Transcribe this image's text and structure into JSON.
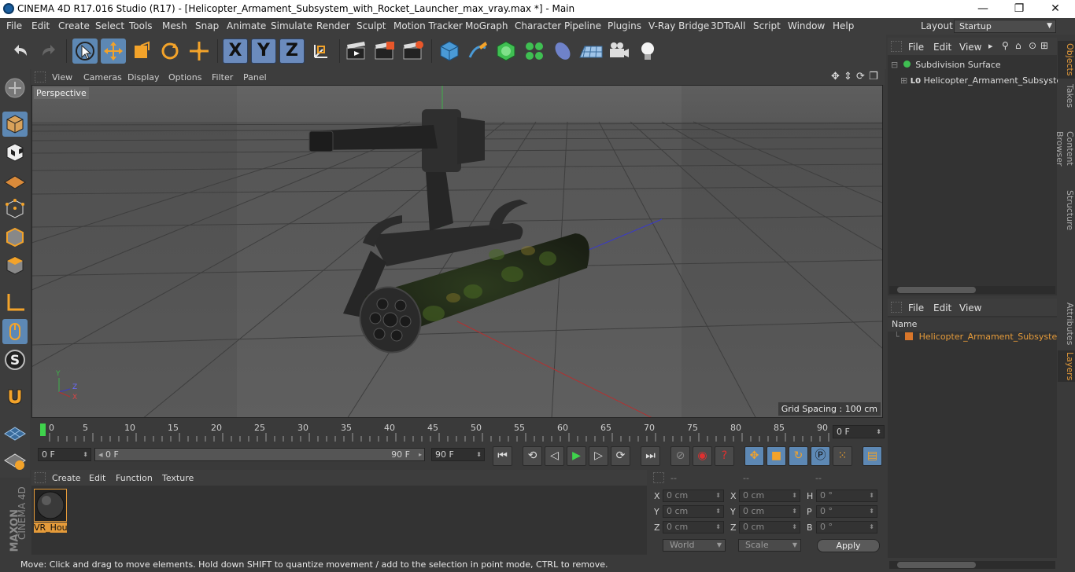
{
  "window": {
    "title": "CINEMA 4D R17.016 Studio (R17) - [Helicopter_Armament_Subsystem_with_Rocket_Launcher_max_vray.max *] - Main",
    "minimize": "—",
    "maximize": "❐",
    "close": "✕"
  },
  "menubar": {
    "items": [
      "File",
      "Edit",
      "Create",
      "Select",
      "Tools",
      "Mesh",
      "Snap",
      "Animate",
      "Simulate",
      "Render",
      "Sculpt",
      "Motion Tracker",
      "MoGraph",
      "Character",
      "Pipeline",
      "Plugins",
      "V-Ray Bridge",
      "3DToAll",
      "Script",
      "Window",
      "Help"
    ],
    "layout_label": "Layout:",
    "layout_value": "Startup"
  },
  "toolbar": {
    "axis_x": "X",
    "axis_y": "Y",
    "axis_z": "Z"
  },
  "viewport": {
    "menu": [
      "View",
      "Cameras",
      "Display",
      "Options",
      "Filter",
      "Panel"
    ],
    "camera_label": "Perspective",
    "grid_spacing": "Grid Spacing : 100 cm",
    "axis_labels": {
      "y": "Y",
      "z": "Z",
      "x": "X"
    }
  },
  "timeline": {
    "ticks": [
      "0",
      "5",
      "10",
      "15",
      "20",
      "25",
      "30",
      "35",
      "40",
      "45",
      "50",
      "55",
      "60",
      "65",
      "70",
      "75",
      "80",
      "85",
      "90"
    ],
    "current_frame": "0 F"
  },
  "timecontrols": {
    "start_field": "0 F",
    "slider_left": "0 F",
    "slider_right": "90 F",
    "end_field": "90 F"
  },
  "material_panel": {
    "menu": [
      "Create",
      "Edit",
      "Function",
      "Texture"
    ],
    "materials": [
      {
        "name": "VR_Hou"
      }
    ]
  },
  "coordinates": {
    "header": [
      "--",
      "--",
      "--"
    ],
    "rows": [
      {
        "l1": "X",
        "v1": "0 cm",
        "l2": "X",
        "v2": "0 cm",
        "l3": "H",
        "v3": "0 °"
      },
      {
        "l1": "Y",
        "v1": "0 cm",
        "l2": "Y",
        "v2": "0 cm",
        "l3": "P",
        "v3": "0 °"
      },
      {
        "l1": "Z",
        "v1": "0 cm",
        "l2": "Z",
        "v2": "0 cm",
        "l3": "B",
        "v3": "0 °"
      }
    ],
    "space": "World",
    "mode": "Scale",
    "apply": "Apply"
  },
  "status": "Move: Click and drag to move elements. Hold down SHIFT to quantize movement / add to the selection in point mode, CTRL to remove.",
  "brand": {
    "maxon": "MAXON",
    "c4d": "CINEMA 4D"
  },
  "object_manager": {
    "menu": [
      "File",
      "Edit",
      "View"
    ],
    "objects": [
      {
        "name": "Subdivision Surface"
      },
      {
        "name": "Helicopter_Armament_Subsystem"
      }
    ],
    "child_tag": "L0"
  },
  "layer_manager": {
    "menu": [
      "File",
      "Edit",
      "View"
    ],
    "column_name": "Name",
    "layers": [
      {
        "name": "Helicopter_Armament_Subsystem_"
      }
    ]
  },
  "side_tabs": [
    "Objects",
    "Takes",
    "Content Browser",
    "Structure",
    "Attributes",
    "Layers"
  ],
  "colors": {
    "accent": "#5d88b4",
    "selection_orange": "#e59b3a",
    "layer_orange": "#d9762a"
  }
}
